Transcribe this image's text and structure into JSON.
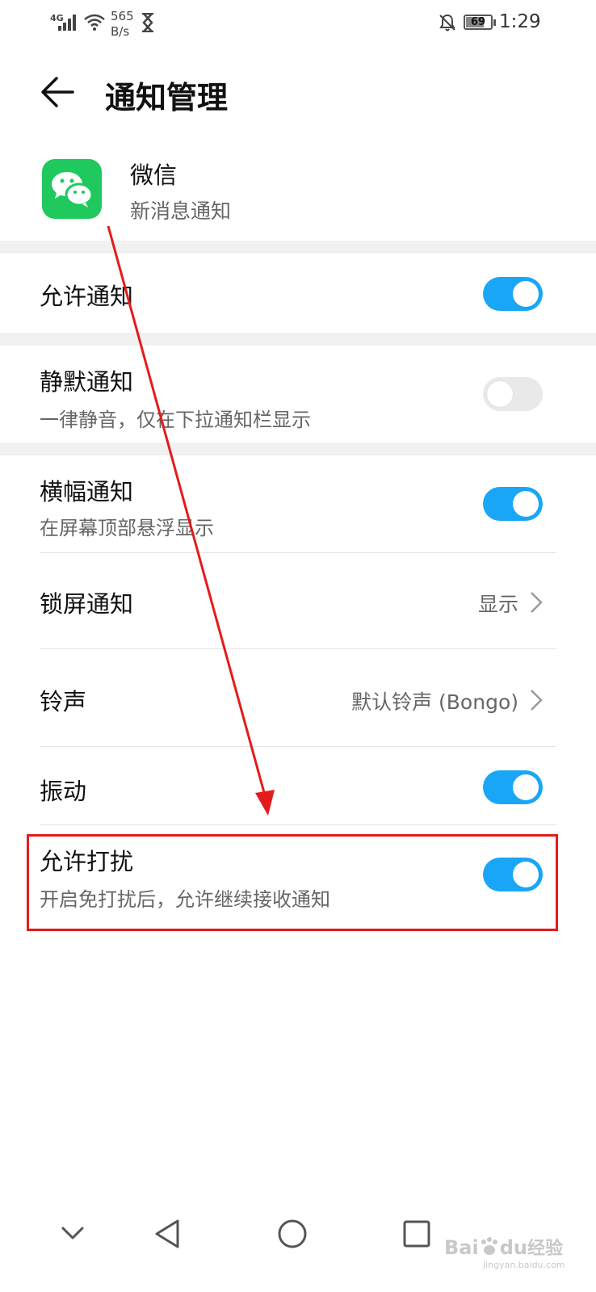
{
  "status_bar": {
    "network": "4G",
    "speed_value": "565",
    "speed_unit": "B/s",
    "battery": "69",
    "time": "1:29"
  },
  "header": {
    "title": "通知管理",
    "back_icon": "arrow-left-icon"
  },
  "app": {
    "name": "微信",
    "subtitle": "新消息通知",
    "icon": "wechat-icon",
    "icon_color": "#1fc95d"
  },
  "settings": {
    "allow_notifications": {
      "title": "允许通知",
      "on": true
    },
    "silent_notifications": {
      "title": "静默通知",
      "subtitle": "一律静音，仅在下拉通知栏显示",
      "on": false
    },
    "banner_notifications": {
      "title": "横幅通知",
      "subtitle": "在屏幕顶部悬浮显示",
      "on": true
    },
    "lock_screen": {
      "title": "锁屏通知",
      "value": "显示"
    },
    "ringtone": {
      "title": "铃声",
      "value": "默认铃声 (Bongo)"
    },
    "vibration": {
      "title": "振动",
      "on": true
    },
    "allow_interrupt": {
      "title": "允许打扰",
      "subtitle": "开启免打扰后，允许继续接收通知",
      "on": true
    }
  },
  "nav_bar": {
    "icons": [
      "chevron-down-icon",
      "back-triangle-icon",
      "home-circle-icon",
      "recents-square-icon"
    ]
  },
  "colors": {
    "toggle_on": "#1aa6f6",
    "annotation": "#e41b1b"
  },
  "watermark": {
    "brand": "Bai",
    "brand_suffix": "du",
    "label": "经验",
    "url": "jingyan.baidu.com"
  }
}
